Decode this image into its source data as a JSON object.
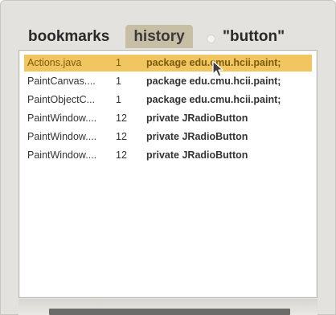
{
  "tabs": [
    {
      "label": "bookmarks"
    },
    {
      "label": "history"
    },
    {
      "label": "\"button\""
    }
  ],
  "selected_tab": "history",
  "rows": [
    {
      "file": "Actions.java",
      "line": "1",
      "code": "package edu.cmu.hcii.paint;"
    },
    {
      "file": "PaintCanvas....",
      "line": "1",
      "code": "package edu.cmu.hcii.paint;"
    },
    {
      "file": "PaintObjectC...",
      "line": "1",
      "code": "package edu.cmu.hcii.paint;"
    },
    {
      "file": "PaintWindow....",
      "line": "12",
      "code": "private JRadioButton"
    },
    {
      "file": "PaintWindow....",
      "line": "12",
      "code": "private JRadioButton"
    },
    {
      "file": "PaintWindow....",
      "line": "12",
      "code": "private JRadioButton"
    }
  ],
  "selected_row": 0,
  "colors": {
    "selected_row_bg": "#f1c55f",
    "selected_row_text": "#7c5a10",
    "active_tab_bg": "#c6bfa6",
    "panel_bg": "#e3e2de"
  },
  "icons": {
    "cursor": "arrow-pointer"
  }
}
